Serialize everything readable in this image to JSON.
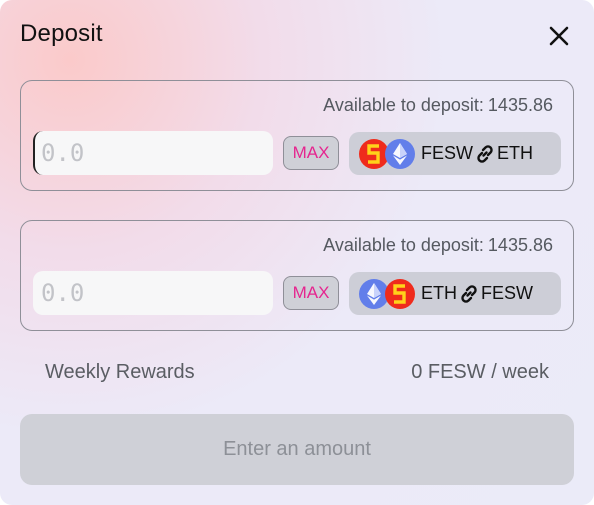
{
  "modal": {
    "title": "Deposit",
    "close_icon": "close-icon"
  },
  "inputs": [
    {
      "available_label": "Available to deposit:",
      "available_value": "1435.86",
      "amount_value": "",
      "amount_placeholder": "0.0",
      "max_label": "MAX",
      "pair": {
        "token_a": "FESW",
        "token_b": "ETH",
        "icon_a": "fesw-token-icon",
        "icon_b": "eth-token-icon",
        "link_icon": "link-icon"
      }
    },
    {
      "available_label": "Available to deposit:",
      "available_value": "1435.86",
      "amount_value": "",
      "amount_placeholder": "0.0",
      "max_label": "MAX",
      "pair": {
        "token_a": "ETH",
        "token_b": "FESW",
        "icon_a": "eth-token-icon",
        "icon_b": "fesw-token-icon",
        "link_icon": "link-icon"
      }
    }
  ],
  "rewards": {
    "label": "Weekly Rewards",
    "value": "0 FESW / week"
  },
  "submit": {
    "label": "Enter an amount"
  },
  "colors": {
    "accent_max": "#e5268f",
    "fesw_token": "#ef2b1c",
    "eth_token": "#627eea",
    "button_disabled_bg": "#cfd0d7"
  }
}
